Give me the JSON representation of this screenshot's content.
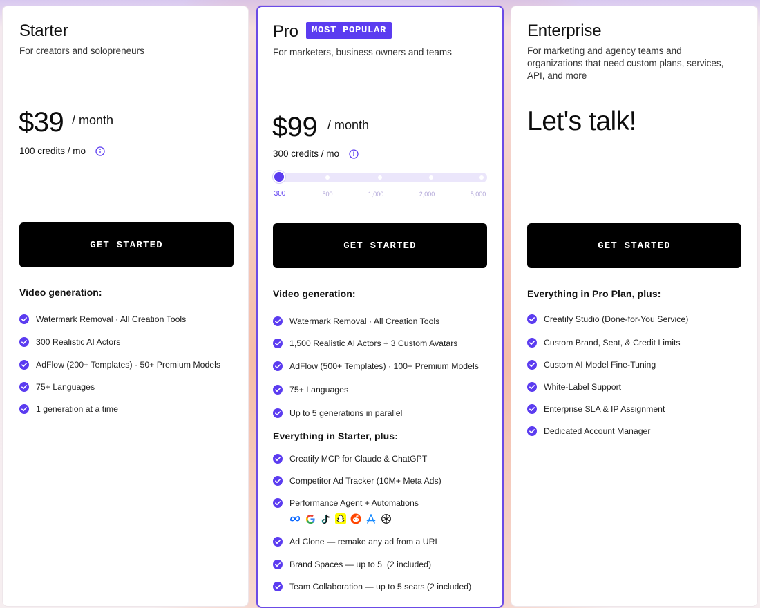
{
  "plans": {
    "starter": {
      "name": "Starter",
      "description": "For creators and solopreneurs",
      "price": "$39",
      "period": "/ month",
      "credits": "100 credits / mo",
      "cta": "GET STARTED",
      "section_title": "Video generation:",
      "features": [
        "Watermark Removal · All Creation Tools",
        "300 Realistic AI Actors",
        "AdFlow (200+ Templates) · 50+ Premium Models",
        "75+ Languages",
        "1 generation at a time"
      ]
    },
    "pro": {
      "name": "Pro",
      "badge": "MOST POPULAR",
      "description": "For marketers, business owners and teams",
      "price": "$99",
      "period": "/ month",
      "credits": "300 credits / mo",
      "slider": {
        "options": [
          "300",
          "500",
          "1,000",
          "2,000",
          "5,000"
        ],
        "selected_index": 0
      },
      "cta": "GET STARTED",
      "section_title": "Video generation:",
      "features": [
        "Watermark Removal · All Creation Tools",
        "1,500 Realistic AI Actors + 3 Custom Avatars",
        "AdFlow (500+ Templates) · 100+ Premium Models",
        "75+ Languages",
        "Up to 5 generations in parallel"
      ],
      "section_title_2": "Everything in Starter, plus:",
      "features_2": [
        "Creatify MCP for Claude & ChatGPT",
        "Competitor Ad Tracker (10M+ Meta Ads)",
        "Performance Agent + Automations",
        "Ad Clone — remake any ad from a URL",
        "Brand Spaces — up to 5  (2 included)",
        "Team Collaboration — up to 5 seats (2 included)"
      ],
      "platform_icons": [
        "meta-icon",
        "google-icon",
        "tiktok-icon",
        "snapchat-icon",
        "reddit-icon",
        "app-store-icon",
        "openai-icon"
      ]
    },
    "enterprise": {
      "name": "Enterprise",
      "description_lines": [
        "For marketing and agency teams and",
        "organizations that need custom plans, services,",
        "API, and more"
      ],
      "headline": "Let's talk!",
      "cta": "GET STARTED",
      "section_title": "Everything in Pro Plan, plus:",
      "features": [
        "Creatify Studio (Done-for-You Service)",
        "Custom Brand, Seat, & Credit Limits",
        "Custom AI Model Fine-Tuning",
        "White-Label Support",
        "Enterprise SLA & IP Assignment",
        "Dedicated Account Manager"
      ]
    }
  },
  "colors": {
    "accent": "#5b3cf0",
    "button_bg": "#000000",
    "check": "#5b3cf0"
  }
}
